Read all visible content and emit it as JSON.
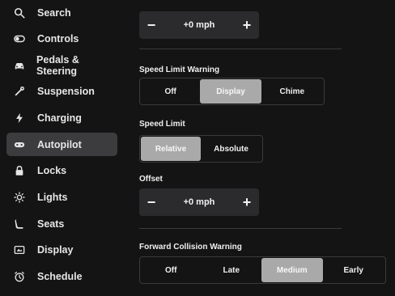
{
  "sidebar": {
    "items": [
      {
        "label": "Search",
        "icon": "search-icon"
      },
      {
        "label": "Controls",
        "icon": "toggle-icon"
      },
      {
        "label": "Pedals & Steering",
        "icon": "car-icon"
      },
      {
        "label": "Suspension",
        "icon": "wrench-icon"
      },
      {
        "label": "Charging",
        "icon": "bolt-icon"
      },
      {
        "label": "Autopilot",
        "icon": "steering-wheel-icon",
        "active": true
      },
      {
        "label": "Locks",
        "icon": "lock-icon"
      },
      {
        "label": "Lights",
        "icon": "sun-icon"
      },
      {
        "label": "Seats",
        "icon": "seat-icon"
      },
      {
        "label": "Display",
        "icon": "display-icon"
      },
      {
        "label": "Schedule",
        "icon": "clock-icon"
      }
    ]
  },
  "main": {
    "top_stepper": {
      "minus": "−",
      "value": "+0 mph",
      "plus": "+"
    },
    "speed_limit_warning": {
      "label": "Speed Limit Warning",
      "options": [
        "Off",
        "Display",
        "Chime"
      ],
      "selected": "Display"
    },
    "speed_limit": {
      "label": "Speed Limit",
      "options": [
        "Relative",
        "Absolute"
      ],
      "selected": "Relative"
    },
    "offset": {
      "label": "Offset",
      "minus": "−",
      "value": "+0 mph",
      "plus": "+"
    },
    "forward_collision_warning": {
      "label": "Forward Collision Warning",
      "options": [
        "Off",
        "Late",
        "Medium",
        "Early"
      ],
      "selected": "Medium"
    }
  },
  "colors": {
    "background": "#141414",
    "active_nav": "#3c3c3e",
    "selected_option": "#a9a9a9",
    "control_bg": "#2b2b2d"
  }
}
